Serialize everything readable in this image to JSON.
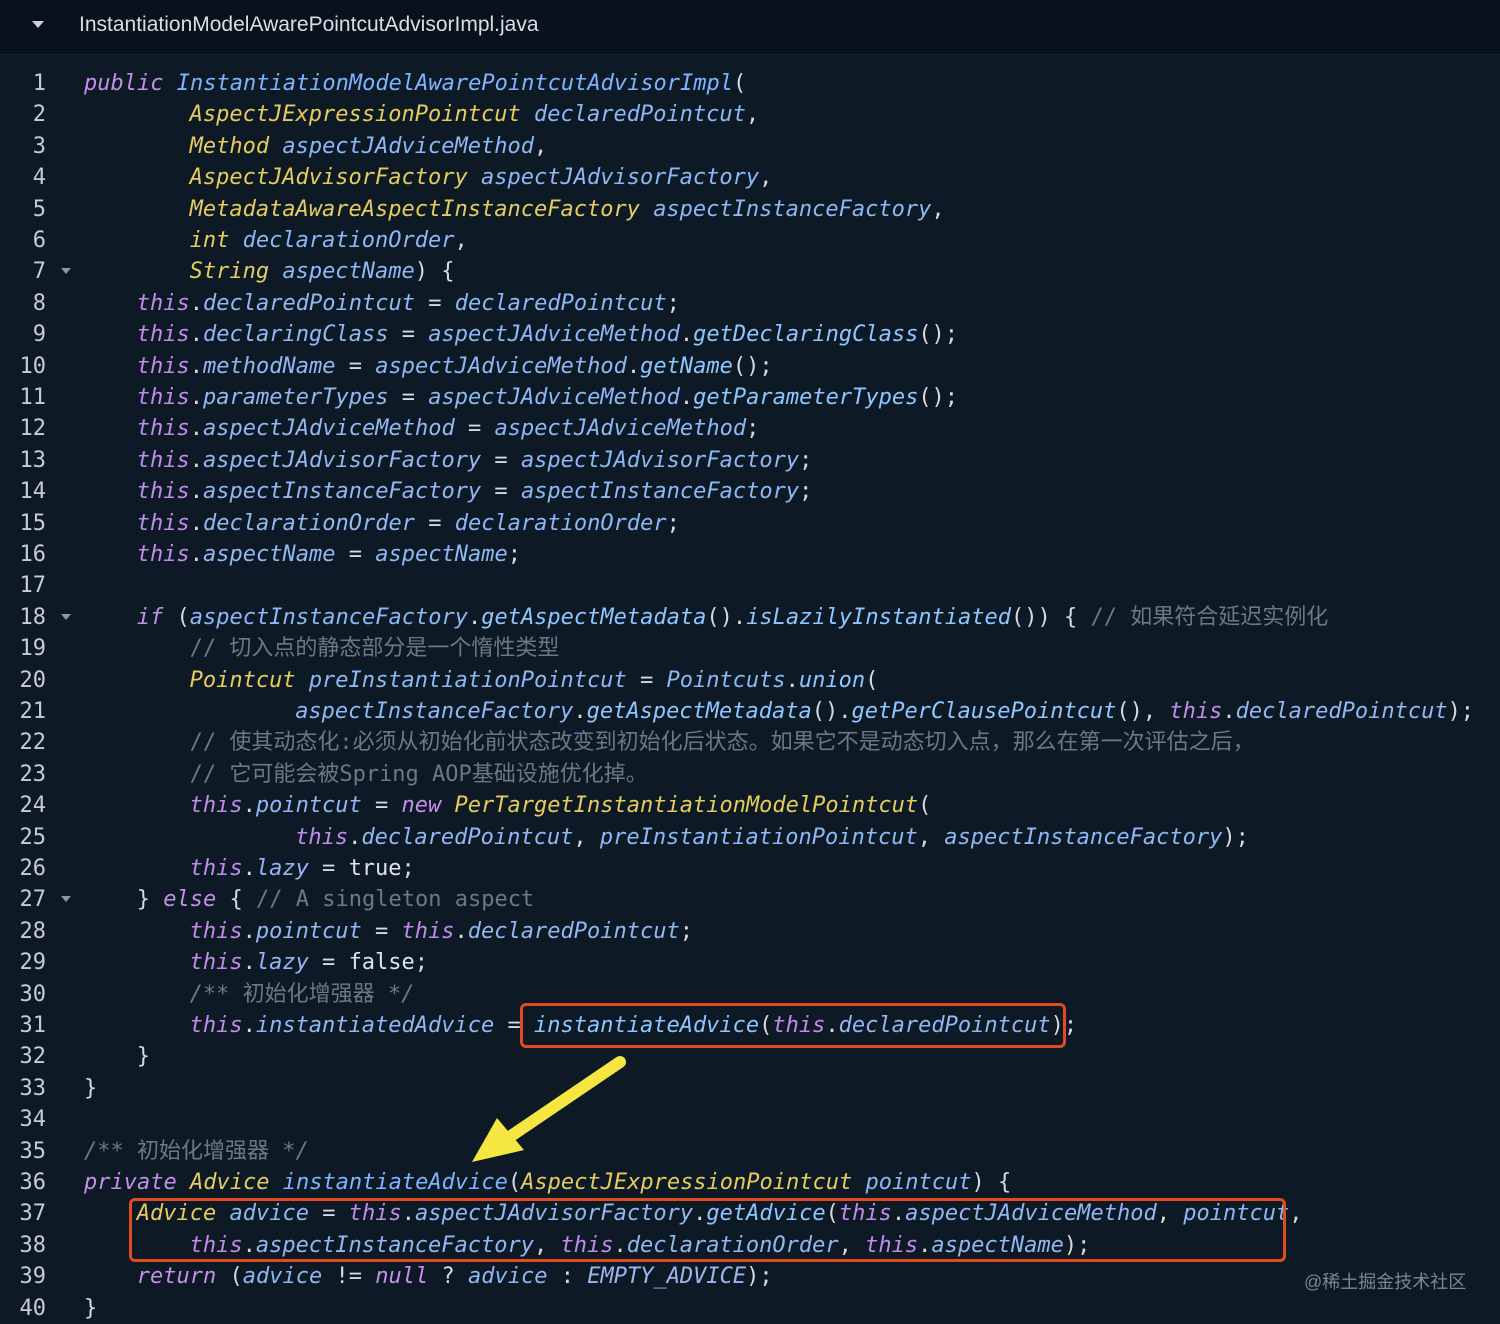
{
  "tab": {
    "title": "InstantiationModelAwarePointcutAdvisorImpl.java",
    "toggle_icon": "chevron-down-icon"
  },
  "editor": {
    "lines": [
      {
        "n": "1",
        "fold": false,
        "indent": 0,
        "tokens": [
          [
            "kw",
            "public"
          ],
          [
            "p",
            " "
          ],
          [
            "def",
            "InstantiationModelAwarePointcutAdvisorImpl"
          ],
          [
            "p",
            "("
          ]
        ]
      },
      {
        "n": "2",
        "fold": false,
        "indent": 8,
        "tokens": [
          [
            "type",
            "AspectJExpressionPointcut"
          ],
          [
            "p",
            " "
          ],
          [
            "var",
            "declaredPointcut"
          ],
          [
            "p",
            ","
          ]
        ]
      },
      {
        "n": "3",
        "fold": false,
        "indent": 8,
        "tokens": [
          [
            "type",
            "Method"
          ],
          [
            "p",
            " "
          ],
          [
            "var",
            "aspectJAdviceMethod"
          ],
          [
            "p",
            ","
          ]
        ]
      },
      {
        "n": "4",
        "fold": false,
        "indent": 8,
        "tokens": [
          [
            "type",
            "AspectJAdvisorFactory"
          ],
          [
            "p",
            " "
          ],
          [
            "var",
            "aspectJAdvisorFactory"
          ],
          [
            "p",
            ","
          ]
        ]
      },
      {
        "n": "5",
        "fold": false,
        "indent": 8,
        "tokens": [
          [
            "type",
            "MetadataAwareAspectInstanceFactory"
          ],
          [
            "p",
            " "
          ],
          [
            "var",
            "aspectInstanceFactory"
          ],
          [
            "p",
            ","
          ]
        ]
      },
      {
        "n": "6",
        "fold": false,
        "indent": 8,
        "tokens": [
          [
            "type",
            "int"
          ],
          [
            "p",
            " "
          ],
          [
            "var",
            "declarationOrder"
          ],
          [
            "p",
            ","
          ]
        ]
      },
      {
        "n": "7",
        "fold": true,
        "indent": 8,
        "tokens": [
          [
            "type",
            "String"
          ],
          [
            "p",
            " "
          ],
          [
            "var",
            "aspectName"
          ],
          [
            "p",
            ") {"
          ]
        ]
      },
      {
        "n": "8",
        "fold": false,
        "indent": 4,
        "tokens": [
          [
            "this",
            "this"
          ],
          [
            "p",
            "."
          ],
          [
            "prop",
            "declaredPointcut"
          ],
          [
            "p",
            " = "
          ],
          [
            "var",
            "declaredPointcut"
          ],
          [
            "p",
            ";"
          ]
        ]
      },
      {
        "n": "9",
        "fold": false,
        "indent": 4,
        "tokens": [
          [
            "this",
            "this"
          ],
          [
            "p",
            "."
          ],
          [
            "prop",
            "declaringClass"
          ],
          [
            "p",
            " = "
          ],
          [
            "var",
            "aspectJAdviceMethod"
          ],
          [
            "p",
            "."
          ],
          [
            "fn",
            "getDeclaringClass"
          ],
          [
            "p",
            "();"
          ]
        ]
      },
      {
        "n": "10",
        "fold": false,
        "indent": 4,
        "tokens": [
          [
            "this",
            "this"
          ],
          [
            "p",
            "."
          ],
          [
            "prop",
            "methodName"
          ],
          [
            "p",
            " = "
          ],
          [
            "var",
            "aspectJAdviceMethod"
          ],
          [
            "p",
            "."
          ],
          [
            "fn",
            "getName"
          ],
          [
            "p",
            "();"
          ]
        ]
      },
      {
        "n": "11",
        "fold": false,
        "indent": 4,
        "tokens": [
          [
            "this",
            "this"
          ],
          [
            "p",
            "."
          ],
          [
            "prop",
            "parameterTypes"
          ],
          [
            "p",
            " = "
          ],
          [
            "var",
            "aspectJAdviceMethod"
          ],
          [
            "p",
            "."
          ],
          [
            "fn",
            "getParameterTypes"
          ],
          [
            "p",
            "();"
          ]
        ]
      },
      {
        "n": "12",
        "fold": false,
        "indent": 4,
        "tokens": [
          [
            "this",
            "this"
          ],
          [
            "p",
            "."
          ],
          [
            "prop",
            "aspectJAdviceMethod"
          ],
          [
            "p",
            " = "
          ],
          [
            "var",
            "aspectJAdviceMethod"
          ],
          [
            "p",
            ";"
          ]
        ]
      },
      {
        "n": "13",
        "fold": false,
        "indent": 4,
        "tokens": [
          [
            "this",
            "this"
          ],
          [
            "p",
            "."
          ],
          [
            "prop",
            "aspectJAdvisorFactory"
          ],
          [
            "p",
            " = "
          ],
          [
            "var",
            "aspectJAdvisorFactory"
          ],
          [
            "p",
            ";"
          ]
        ]
      },
      {
        "n": "14",
        "fold": false,
        "indent": 4,
        "tokens": [
          [
            "this",
            "this"
          ],
          [
            "p",
            "."
          ],
          [
            "prop",
            "aspectInstanceFactory"
          ],
          [
            "p",
            " = "
          ],
          [
            "var",
            "aspectInstanceFactory"
          ],
          [
            "p",
            ";"
          ]
        ]
      },
      {
        "n": "15",
        "fold": false,
        "indent": 4,
        "tokens": [
          [
            "this",
            "this"
          ],
          [
            "p",
            "."
          ],
          [
            "prop",
            "declarationOrder"
          ],
          [
            "p",
            " = "
          ],
          [
            "var",
            "declarationOrder"
          ],
          [
            "p",
            ";"
          ]
        ]
      },
      {
        "n": "16",
        "fold": false,
        "indent": 4,
        "tokens": [
          [
            "this",
            "this"
          ],
          [
            "p",
            "."
          ],
          [
            "prop",
            "aspectName"
          ],
          [
            "p",
            " = "
          ],
          [
            "var",
            "aspectName"
          ],
          [
            "p",
            ";"
          ]
        ]
      },
      {
        "n": "17",
        "fold": false,
        "indent": 0,
        "tokens": []
      },
      {
        "n": "18",
        "fold": true,
        "indent": 4,
        "tokens": [
          [
            "kw",
            "if"
          ],
          [
            "p",
            " ("
          ],
          [
            "var",
            "aspectInstanceFactory"
          ],
          [
            "p",
            "."
          ],
          [
            "fn",
            "getAspectMetadata"
          ],
          [
            "p",
            "()."
          ],
          [
            "fn",
            "isLazilyInstantiated"
          ],
          [
            "p",
            "()) { "
          ],
          [
            "cmt",
            "// 如果符合延迟实例化"
          ]
        ]
      },
      {
        "n": "19",
        "fold": false,
        "indent": 8,
        "tokens": [
          [
            "cmt",
            "// 切入点的静态部分是一个惰性类型"
          ]
        ]
      },
      {
        "n": "20",
        "fold": false,
        "indent": 8,
        "tokens": [
          [
            "type",
            "Pointcut"
          ],
          [
            "p",
            " "
          ],
          [
            "var",
            "preInstantiationPointcut"
          ],
          [
            "p",
            " = "
          ],
          [
            "var",
            "Pointcuts"
          ],
          [
            "p",
            "."
          ],
          [
            "fn",
            "union"
          ],
          [
            "p",
            "("
          ]
        ]
      },
      {
        "n": "21",
        "fold": false,
        "indent": 16,
        "tokens": [
          [
            "var",
            "aspectInstanceFactory"
          ],
          [
            "p",
            "."
          ],
          [
            "fn",
            "getAspectMetadata"
          ],
          [
            "p",
            "()."
          ],
          [
            "fn",
            "getPerClausePointcut"
          ],
          [
            "p",
            "(), "
          ],
          [
            "this",
            "this"
          ],
          [
            "p",
            "."
          ],
          [
            "prop",
            "declaredPointcut"
          ],
          [
            "p",
            ");"
          ]
        ]
      },
      {
        "n": "22",
        "fold": false,
        "indent": 8,
        "tokens": [
          [
            "cmt",
            "// 使其动态化:必须从初始化前状态改变到初始化后状态。如果它不是动态切入点，那么在第一次评估之后，"
          ]
        ]
      },
      {
        "n": "23",
        "fold": false,
        "indent": 8,
        "tokens": [
          [
            "cmt",
            "// 它可能会被Spring AOP基础设施优化掉。"
          ]
        ]
      },
      {
        "n": "24",
        "fold": false,
        "indent": 8,
        "tokens": [
          [
            "this",
            "this"
          ],
          [
            "p",
            "."
          ],
          [
            "prop",
            "pointcut"
          ],
          [
            "p",
            " = "
          ],
          [
            "kw",
            "new"
          ],
          [
            "p",
            " "
          ],
          [
            "type",
            "PerTargetInstantiationModelPointcut"
          ],
          [
            "p",
            "("
          ]
        ]
      },
      {
        "n": "25",
        "fold": false,
        "indent": 16,
        "tokens": [
          [
            "this",
            "this"
          ],
          [
            "p",
            "."
          ],
          [
            "prop",
            "declaredPointcut"
          ],
          [
            "p",
            ", "
          ],
          [
            "var",
            "preInstantiationPointcut"
          ],
          [
            "p",
            ", "
          ],
          [
            "var",
            "aspectInstanceFactory"
          ],
          [
            "p",
            ");"
          ]
        ]
      },
      {
        "n": "26",
        "fold": false,
        "indent": 8,
        "tokens": [
          [
            "this",
            "this"
          ],
          [
            "p",
            "."
          ],
          [
            "prop",
            "lazy"
          ],
          [
            "p",
            " = "
          ],
          [
            "lit",
            "true"
          ],
          [
            "p",
            ";"
          ]
        ]
      },
      {
        "n": "27",
        "fold": true,
        "indent": 4,
        "tokens": [
          [
            "p",
            "} "
          ],
          [
            "kw",
            "else"
          ],
          [
            "p",
            " { "
          ],
          [
            "cmt",
            "// A singleton aspect"
          ]
        ]
      },
      {
        "n": "28",
        "fold": false,
        "indent": 8,
        "tokens": [
          [
            "this",
            "this"
          ],
          [
            "p",
            "."
          ],
          [
            "prop",
            "pointcut"
          ],
          [
            "p",
            " = "
          ],
          [
            "this",
            "this"
          ],
          [
            "p",
            "."
          ],
          [
            "prop",
            "declaredPointcut"
          ],
          [
            "p",
            ";"
          ]
        ]
      },
      {
        "n": "29",
        "fold": false,
        "indent": 8,
        "tokens": [
          [
            "this",
            "this"
          ],
          [
            "p",
            "."
          ],
          [
            "prop",
            "lazy"
          ],
          [
            "p",
            " = "
          ],
          [
            "lit",
            "false"
          ],
          [
            "p",
            ";"
          ]
        ]
      },
      {
        "n": "30",
        "fold": false,
        "indent": 8,
        "tokens": [
          [
            "cmti",
            "/** "
          ],
          [
            "cmt",
            "初始化增强器"
          ],
          [
            "cmti",
            " */"
          ]
        ]
      },
      {
        "n": "31",
        "fold": false,
        "indent": 8,
        "tokens": [
          [
            "this",
            "this"
          ],
          [
            "p",
            "."
          ],
          [
            "prop",
            "instantiatedAdvice"
          ],
          [
            "p",
            " = "
          ],
          [
            "fn",
            "instantiateAdvice"
          ],
          [
            "p",
            "("
          ],
          [
            "this",
            "this"
          ],
          [
            "p",
            "."
          ],
          [
            "prop",
            "declaredPointcut"
          ],
          [
            "p",
            ");"
          ]
        ]
      },
      {
        "n": "32",
        "fold": false,
        "indent": 4,
        "tokens": [
          [
            "p",
            "}"
          ]
        ]
      },
      {
        "n": "33",
        "fold": false,
        "indent": 0,
        "tokens": [
          [
            "p",
            "}"
          ]
        ]
      },
      {
        "n": "34",
        "fold": false,
        "indent": 0,
        "tokens": []
      },
      {
        "n": "35",
        "fold": false,
        "indent": 0,
        "tokens": [
          [
            "cmti",
            "/** "
          ],
          [
            "cmt",
            "初始化增强器"
          ],
          [
            "cmti",
            " */"
          ]
        ]
      },
      {
        "n": "36",
        "fold": false,
        "indent": 0,
        "tokens": [
          [
            "kw",
            "private"
          ],
          [
            "p",
            " "
          ],
          [
            "type",
            "Advice"
          ],
          [
            "p",
            " "
          ],
          [
            "def",
            "instantiateAdvice"
          ],
          [
            "p",
            "("
          ],
          [
            "type",
            "AspectJExpressionPointcut"
          ],
          [
            "p",
            " "
          ],
          [
            "var",
            "pointcut"
          ],
          [
            "p",
            ") {"
          ]
        ]
      },
      {
        "n": "37",
        "fold": false,
        "indent": 4,
        "tokens": [
          [
            "type",
            "Advice"
          ],
          [
            "p",
            " "
          ],
          [
            "var",
            "advice"
          ],
          [
            "p",
            " = "
          ],
          [
            "this",
            "this"
          ],
          [
            "p",
            "."
          ],
          [
            "prop",
            "aspectJAdvisorFactory"
          ],
          [
            "p",
            "."
          ],
          [
            "fn",
            "getAdvice"
          ],
          [
            "p",
            "("
          ],
          [
            "this",
            "this"
          ],
          [
            "p",
            "."
          ],
          [
            "prop",
            "aspectJAdviceMethod"
          ],
          [
            "p",
            ", "
          ],
          [
            "var",
            "pointcut"
          ],
          [
            "p",
            ","
          ]
        ]
      },
      {
        "n": "38",
        "fold": false,
        "indent": 8,
        "tokens": [
          [
            "this",
            "this"
          ],
          [
            "p",
            "."
          ],
          [
            "prop",
            "aspectInstanceFactory"
          ],
          [
            "p",
            ", "
          ],
          [
            "this",
            "this"
          ],
          [
            "p",
            "."
          ],
          [
            "prop",
            "declarationOrder"
          ],
          [
            "p",
            ", "
          ],
          [
            "this",
            "this"
          ],
          [
            "p",
            "."
          ],
          [
            "prop",
            "aspectName"
          ],
          [
            "p",
            ");"
          ]
        ]
      },
      {
        "n": "39",
        "fold": false,
        "indent": 4,
        "tokens": [
          [
            "kw",
            "return"
          ],
          [
            "p",
            " ("
          ],
          [
            "var",
            "advice"
          ],
          [
            "p",
            " != "
          ],
          [
            "kw",
            "null"
          ],
          [
            "p",
            " ? "
          ],
          [
            "var",
            "advice"
          ],
          [
            "p",
            " : "
          ],
          [
            "const",
            "EMPTY_ADVICE"
          ],
          [
            "p",
            ");"
          ]
        ]
      },
      {
        "n": "40",
        "fold": false,
        "indent": 0,
        "tokens": [
          [
            "p",
            "}"
          ]
        ]
      }
    ]
  },
  "annotations": {
    "highlight_color": "#e24a1f",
    "arrow_color": "#f5e642",
    "arrow_icon": "arrow-down-left-icon"
  },
  "watermark": "@稀土掘金技术社区"
}
